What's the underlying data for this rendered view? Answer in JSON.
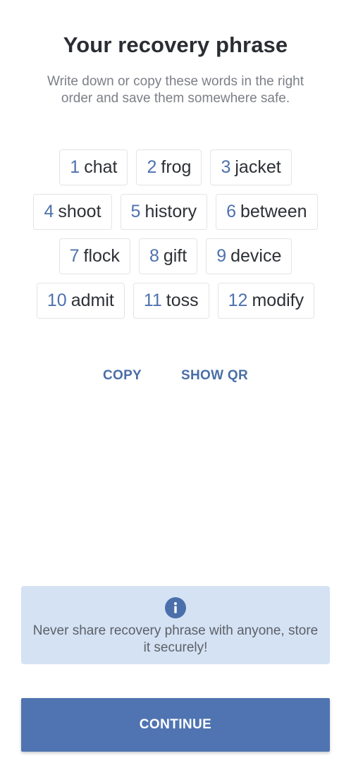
{
  "header": {
    "title": "Your recovery phrase",
    "subtitle": "Write down or copy these words in the right order and save them somewhere safe."
  },
  "phrase": {
    "rows": [
      [
        {
          "index": "1",
          "word": "chat"
        },
        {
          "index": "2",
          "word": "frog"
        },
        {
          "index": "3",
          "word": "jacket"
        }
      ],
      [
        {
          "index": "4",
          "word": "shoot"
        },
        {
          "index": "5",
          "word": "history"
        },
        {
          "index": "6",
          "word": "between"
        }
      ],
      [
        {
          "index": "7",
          "word": "flock"
        },
        {
          "index": "8",
          "word": "gift"
        },
        {
          "index": "9",
          "word": "device"
        }
      ],
      [
        {
          "index": "10",
          "word": "admit"
        },
        {
          "index": "11",
          "word": "toss"
        },
        {
          "index": "12",
          "word": "modify"
        }
      ]
    ]
  },
  "actions": {
    "copy_label": "COPY",
    "show_qr_label": "SHOW QR"
  },
  "notice": {
    "icon": "info-icon",
    "text": "Never share recovery phrase with anyone, store it securely!"
  },
  "footer": {
    "continue_label": "CONTINUE"
  },
  "colors": {
    "accent": "#4f74b1",
    "word_index": "#4e71ad",
    "notice_bg": "#d4e2f4"
  }
}
